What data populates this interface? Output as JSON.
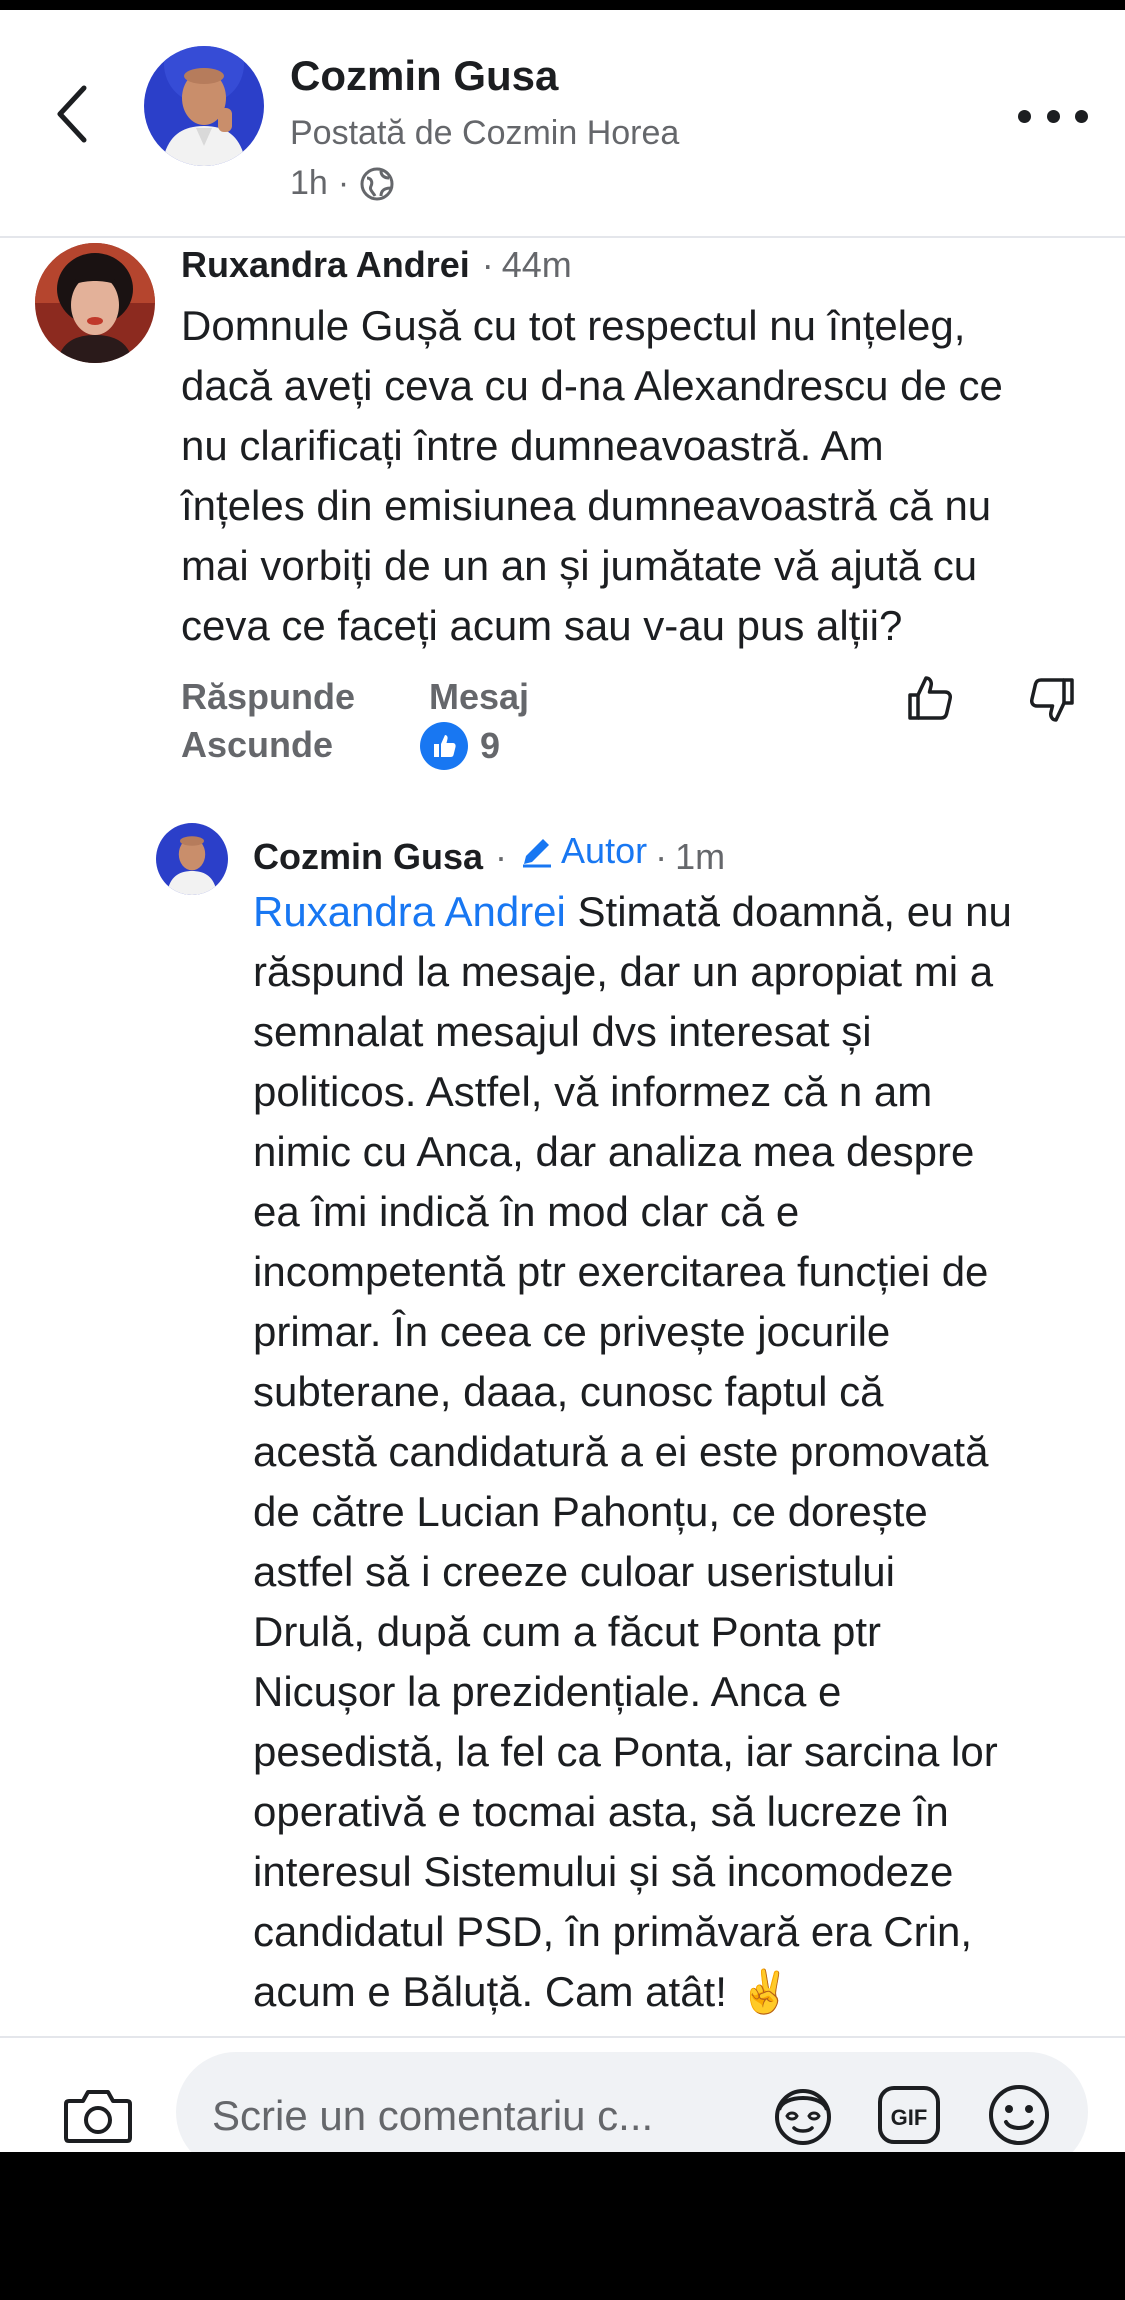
{
  "post": {
    "author": "Cozmin Gusa",
    "posted_by": "Postată de Cozmin Horea",
    "time": "1h",
    "meta_separator": "·"
  },
  "comments": [
    {
      "author": "Ruxandra Andrei",
      "separator": "·",
      "time": "44m",
      "text": "Domnule Gușă cu tot respectul nu înțeleg,\ndacă aveți ceva cu d-na Alexandrescu de ce\nnu clarificați între dumneavoastră. Am\nînțeles din emisiunea dumneavoastră că nu\nmai vorbiți de un an și jumătate vă ajută cu\nceva ce faceți acum sau v-au pus alții?",
      "reply_label": "Răspunde",
      "message_label": "Mesaj",
      "hide_label": "Ascunde",
      "like_count": "9"
    }
  ],
  "reply": {
    "author": "Cozmin Gusa",
    "separator": "·",
    "badge": "Autor",
    "separator2": "·",
    "time": "1m",
    "mention": "Ruxandra Andrei",
    "text": " Stimată doamnă, eu nu\nrăspund la mesaje, dar un apropiat mi a\nsemnalat mesajul dvs interesat și\npoliticos. Astfel, vă informez că n am\nnimic cu Anca, dar analiza mea despre\nea îmi indică în mod clar că e\nincompetentă ptr exercitarea funcției de\nprimar. În ceea ce privește jocurile\nsubterane, daaa, cunosc faptul că\nacestă candidatură a ei este promovată\nde către Lucian Pahonțu, ce dorește\nastfel să i creeze culoar useristului\nDrulă, după cum a făcut Ponta ptr\nNicușor la prezidențiale. Anca e\npesedistă, la fel ca Ponta, iar sarcina lor\noperativă e tocmai asta, să lucreze în\ninteresul Sistemului și să incomodeze\ncandidatul PSD, în primăvară era Crin,\nacum e Băluță. Cam atât! ✌️"
  },
  "composer": {
    "placeholder": "Scrie un comentariu c..."
  },
  "icons": {
    "back": "chevron-left-icon",
    "more": "more-horizontal-icon",
    "globe": "globe-icon",
    "upvote": "thumbs-up-icon",
    "downvote": "thumbs-down-icon",
    "like_reaction": "like-reaction-icon",
    "author_badge": "pencil-icon",
    "camera": "camera-icon",
    "avatar_sticker": "avatar-sticker-icon",
    "gif": "gif-icon",
    "emoji": "emoji-icon"
  },
  "colors": {
    "accent": "#1877f2",
    "text": "#1c1e21",
    "secondary": "#65676b",
    "composer_bg": "#f0f2f5"
  }
}
